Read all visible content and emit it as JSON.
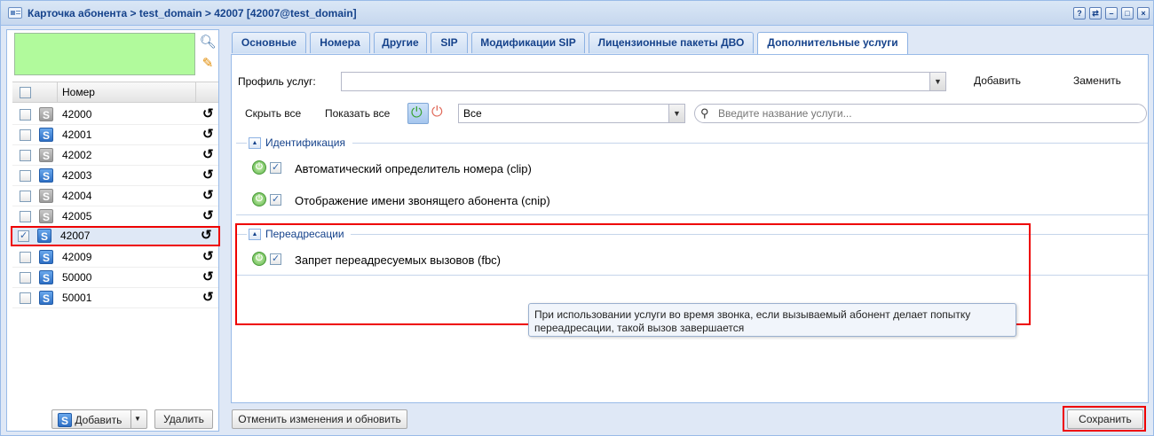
{
  "window": {
    "title": "Карточка абонента > test_domain > 42007 [42007@test_domain]",
    "tools": [
      "?",
      "⇄",
      "–",
      "□",
      "×"
    ]
  },
  "left": {
    "column_header": "Номер",
    "rows": [
      {
        "number": "42000",
        "icon": "gray",
        "checked": false,
        "selected": false
      },
      {
        "number": "42001",
        "icon": "blue",
        "checked": false,
        "selected": false
      },
      {
        "number": "42002",
        "icon": "gray",
        "checked": false,
        "selected": false
      },
      {
        "number": "42003",
        "icon": "blue",
        "checked": false,
        "selected": false
      },
      {
        "number": "42004",
        "icon": "gray",
        "checked": false,
        "selected": false
      },
      {
        "number": "42005",
        "icon": "gray",
        "checked": false,
        "selected": false
      },
      {
        "number": "42007",
        "icon": "blue",
        "checked": true,
        "selected": true
      },
      {
        "number": "42009",
        "icon": "blue",
        "checked": false,
        "selected": false
      },
      {
        "number": "50000",
        "icon": "blue",
        "checked": false,
        "selected": false
      },
      {
        "number": "50001",
        "icon": "blue",
        "checked": false,
        "selected": false
      }
    ],
    "add_label": "Добавить",
    "delete_label": "Удалить"
  },
  "tabs": [
    {
      "label": "Основные",
      "active": false
    },
    {
      "label": "Номера",
      "active": false
    },
    {
      "label": "Другие",
      "active": false
    },
    {
      "label": "SIP",
      "active": false
    },
    {
      "label": "Модификации SIP",
      "active": false
    },
    {
      "label": "Лицензионные пакеты ДВО",
      "active": false
    },
    {
      "label": "Дополнительные услуги",
      "active": true
    }
  ],
  "profile": {
    "label": "Профиль услуг:",
    "value": "",
    "add_label": "Добавить",
    "replace_label": "Заменить"
  },
  "filter": {
    "hide_all": "Скрыть все",
    "show_all": "Показать все",
    "select_value": "Все",
    "search_placeholder": "Введите название услуги..."
  },
  "groups": {
    "identification": {
      "title": "Идентификация",
      "services": [
        {
          "label": "Автоматический определитель номера (clip)",
          "checked": true
        },
        {
          "label": "Отображение имени звонящего абонента (cnip)",
          "checked": true
        }
      ]
    },
    "forwarding": {
      "title": "Переадресации",
      "services": [
        {
          "label": "Запрет переадресуемых вызовов (fbc)",
          "checked": true
        }
      ]
    }
  },
  "tooltip": "При использовании услуги во время звонка, если вызываемый абонент делает попытку переадресации, такой вызов завершается",
  "footer": {
    "cancel_label": "Отменить изменения и обновить",
    "save_label": "Сохранить"
  },
  "colors": {
    "accent": "#15428b",
    "green_box": "#b1fa9c",
    "highlight": "#ee0000"
  }
}
